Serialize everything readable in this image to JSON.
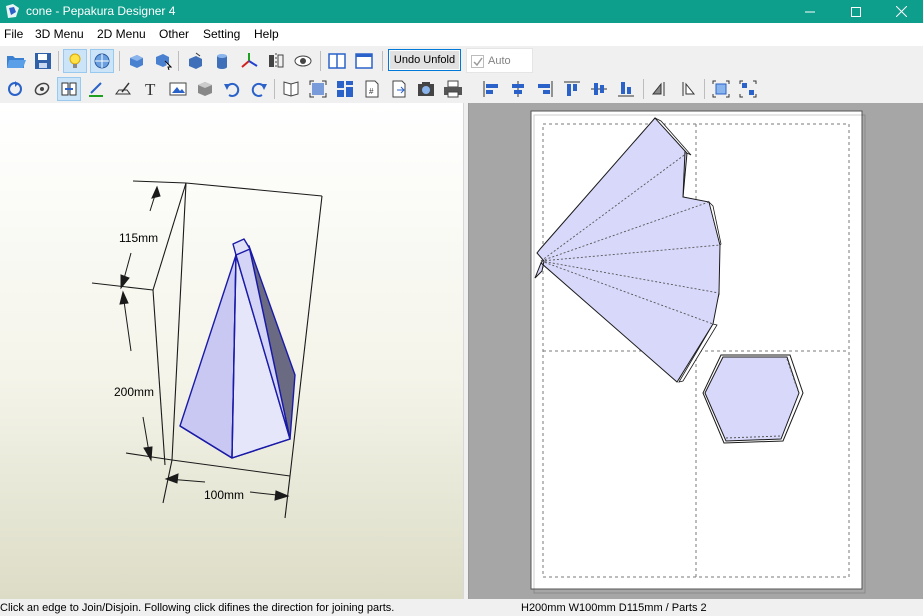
{
  "window": {
    "title": "cone - Pepakura Designer 4"
  },
  "menu": [
    "File",
    "3D Menu",
    "2D Menu",
    "Other",
    "Setting",
    "Help"
  ],
  "toolbar": {
    "undo_unfold_label": "Undo Unfold",
    "auto_label": "Auto",
    "auto_checked": true
  },
  "view3d": {
    "height_label": "200mm",
    "depth_label": "115mm",
    "width_label": "100mm"
  },
  "status": {
    "message": "Click an edge to Join/Disjoin. Following click difines the direction for joining parts.",
    "dimensions": "H200mm W100mm D115mm / Parts 2"
  },
  "colors": {
    "titlebar": "#0d9e8c",
    "face_fill": "#d8d8fb",
    "edge_blue": "#1a1aa8"
  }
}
